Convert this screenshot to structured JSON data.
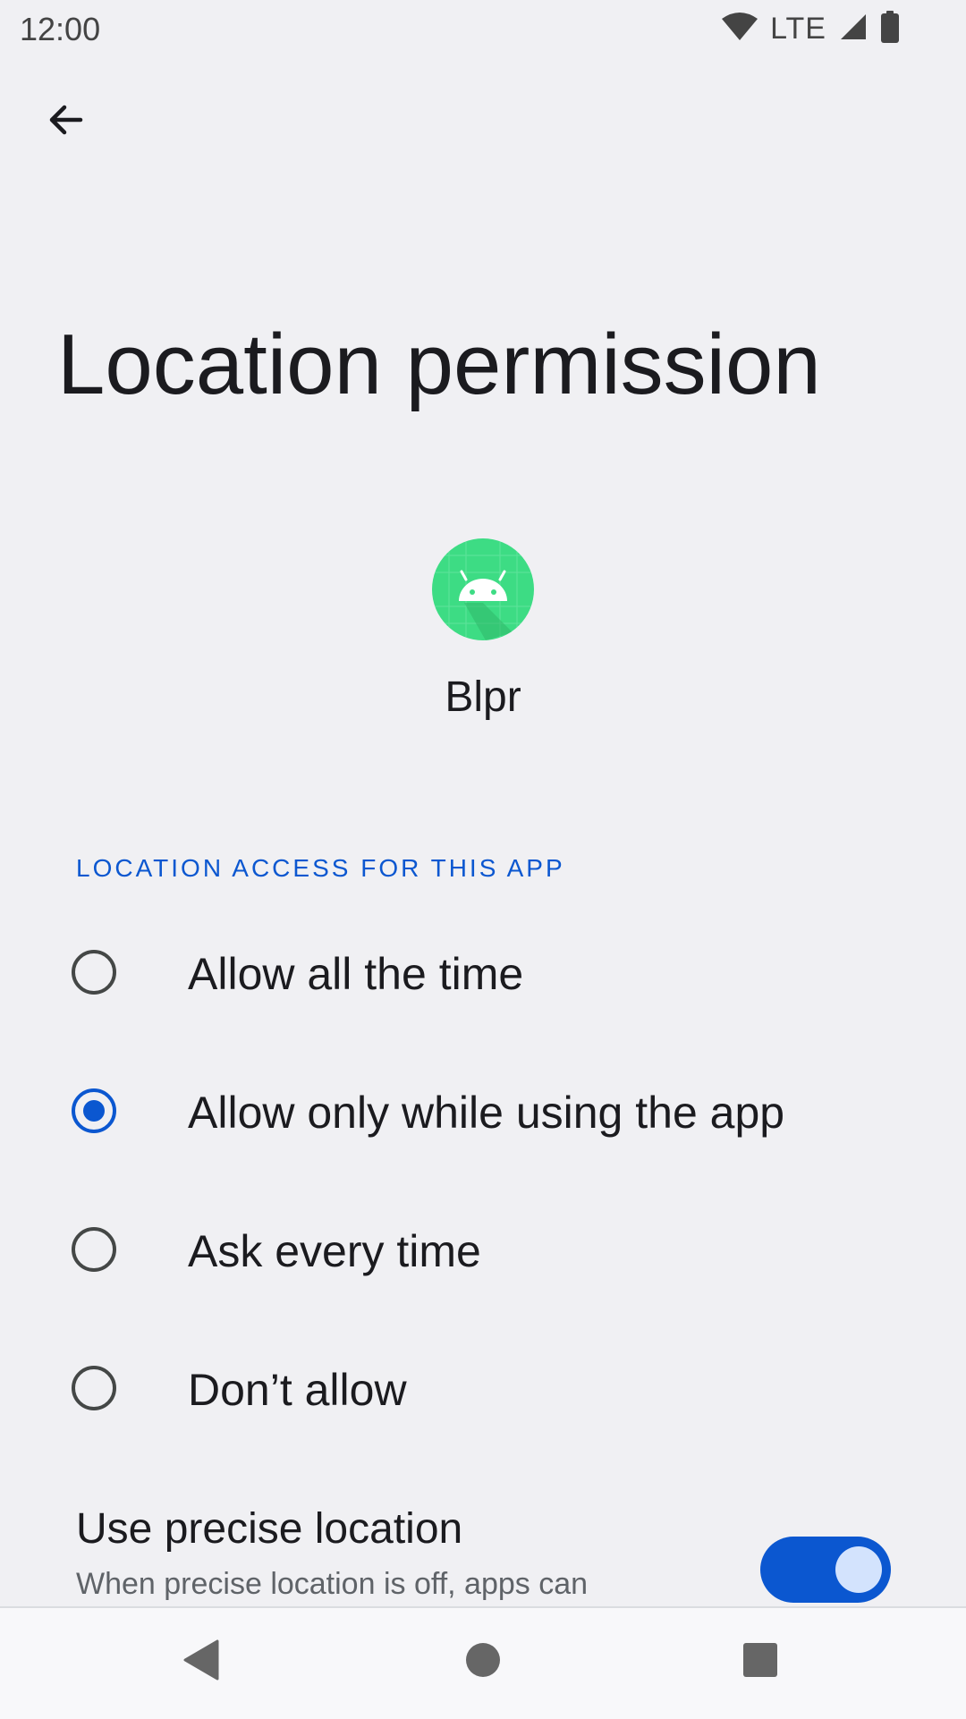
{
  "status_bar": {
    "time": "12:00",
    "network": "LTE",
    "icons": [
      "wifi-icon",
      "cell-signal-icon",
      "battery-icon"
    ]
  },
  "toolbar": {
    "back_icon": "arrow-back-icon"
  },
  "page": {
    "title": "Location permission",
    "app_name": "Blpr",
    "app_icon": "android-app-icon"
  },
  "section": {
    "header": "LOCATION ACCESS FOR THIS APP"
  },
  "options": [
    {
      "label": "Allow all the time",
      "selected": false
    },
    {
      "label": "Allow only while using the app",
      "selected": true
    },
    {
      "label": "Ask every time",
      "selected": false
    },
    {
      "label": "Don’t allow",
      "selected": false
    }
  ],
  "precise_location": {
    "title": "Use precise location",
    "description": "When precise location is off, apps can",
    "enabled": true
  },
  "nav_bar": {
    "icons": [
      "back-triangle-icon",
      "home-circle-icon",
      "recents-square-icon"
    ]
  },
  "colors": {
    "accent": "#0b57d0",
    "background": "#f0f0f3",
    "app_icon_green": "#3ddc84"
  }
}
